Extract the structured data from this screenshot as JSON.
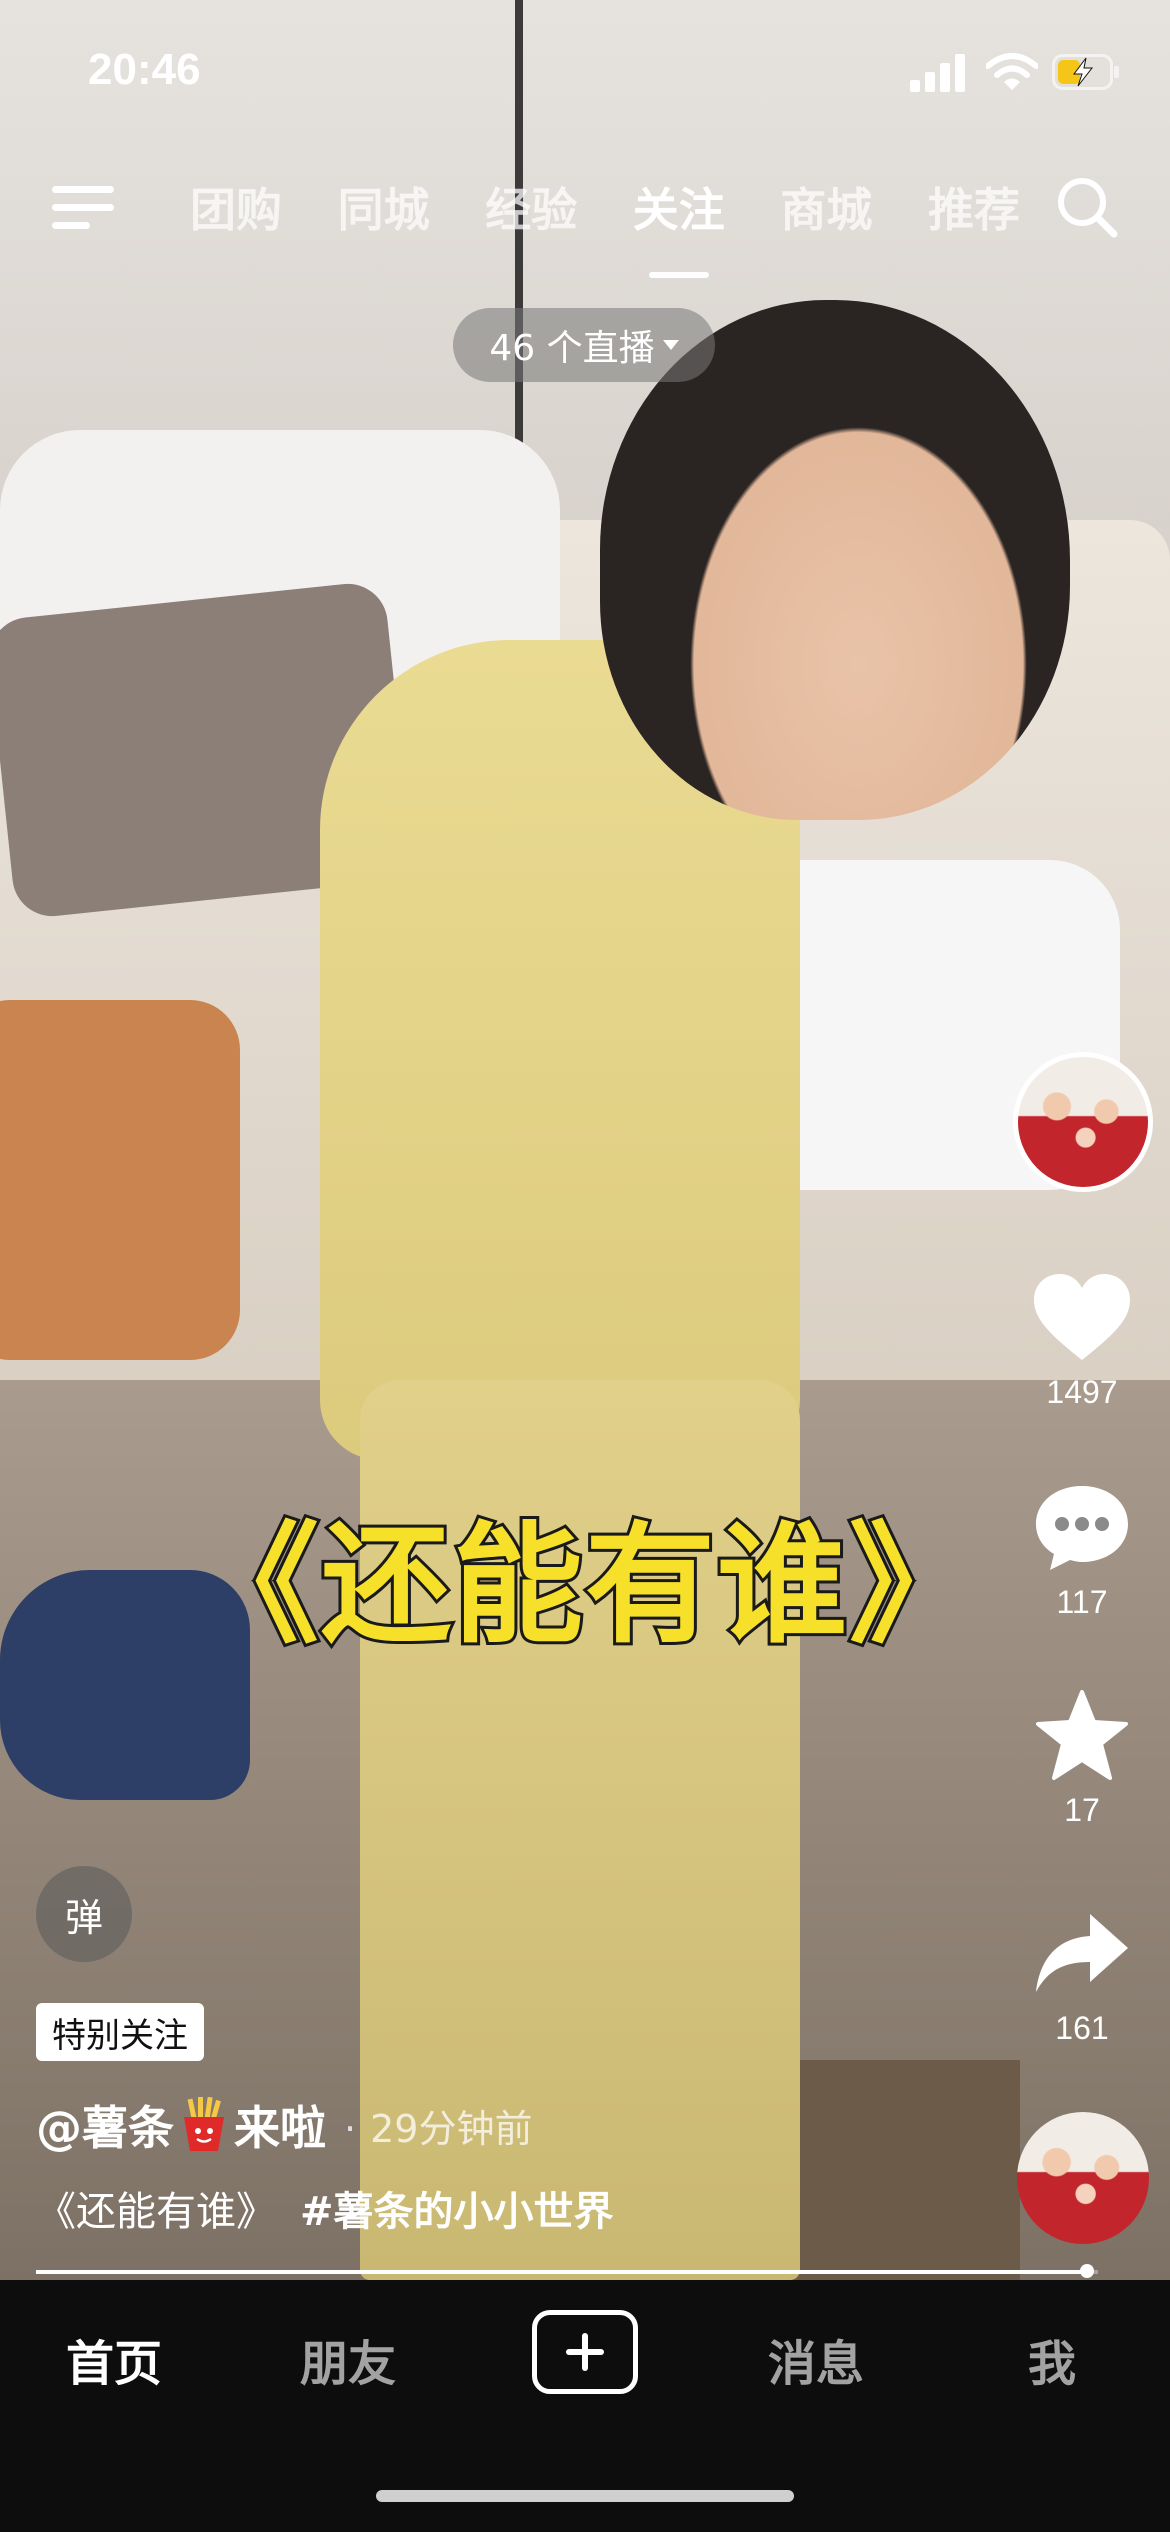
{
  "status_bar": {
    "time": "20:46",
    "icons": [
      "signal-icon",
      "wifi-icon",
      "battery-charging-icon"
    ],
    "battery_color": "#f5c518"
  },
  "top_nav": {
    "menu_icon": "menu-icon",
    "tabs": [
      {
        "label": "团购",
        "active": false
      },
      {
        "label": "同城",
        "active": false
      },
      {
        "label": "经验",
        "active": false
      },
      {
        "label": "关注",
        "active": true
      },
      {
        "label": "商城",
        "active": false
      },
      {
        "label": "推荐",
        "active": false
      }
    ],
    "search_icon": "search-icon"
  },
  "live_pill": {
    "label": "46 个直播"
  },
  "actions": {
    "likes": "1497",
    "comments": "117",
    "favorites": "17",
    "shares": "161"
  },
  "caption_overlay": "《还能有谁》",
  "danmu_button": "弹",
  "post": {
    "tag": "特别关注",
    "author_prefix": "@薯条",
    "author_suffix": "来啦",
    "author_emoji_icon": "french-fries-icon",
    "time_ago": "29分钟前",
    "title": "《还能有谁》",
    "hashtag": "#薯条的小小世界"
  },
  "progress": 0.99,
  "bottom_tabs": {
    "home": "首页",
    "friends": "朋友",
    "create_icon": "plus-icon",
    "messages": "消息",
    "me": "我"
  }
}
